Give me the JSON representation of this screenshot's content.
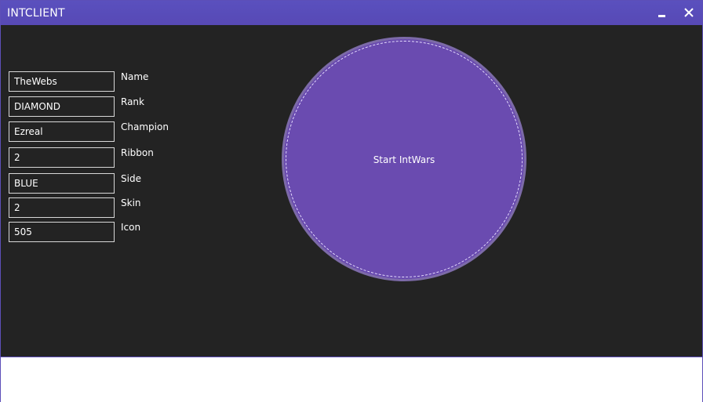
{
  "window": {
    "title": "INTCLIENT",
    "minimize_icon": "minimize-icon",
    "close_icon": "close-icon"
  },
  "fields": [
    {
      "label": "Name",
      "value": "TheWebs"
    },
    {
      "label": "Rank",
      "value": "DIAMOND"
    },
    {
      "label": "Champion",
      "value": "Ezreal"
    },
    {
      "label": "Ribbon",
      "value": "2"
    },
    {
      "label": "Side",
      "value": "BLUE"
    },
    {
      "label": "Skin",
      "value": "2"
    },
    {
      "label": "Icon",
      "value": "505"
    }
  ],
  "start_button": {
    "label": "Start IntWars"
  },
  "colors": {
    "titlebar": "#5749b5",
    "background": "#232323",
    "button_fill": "#6a4bb0",
    "text": "#ffffff"
  }
}
